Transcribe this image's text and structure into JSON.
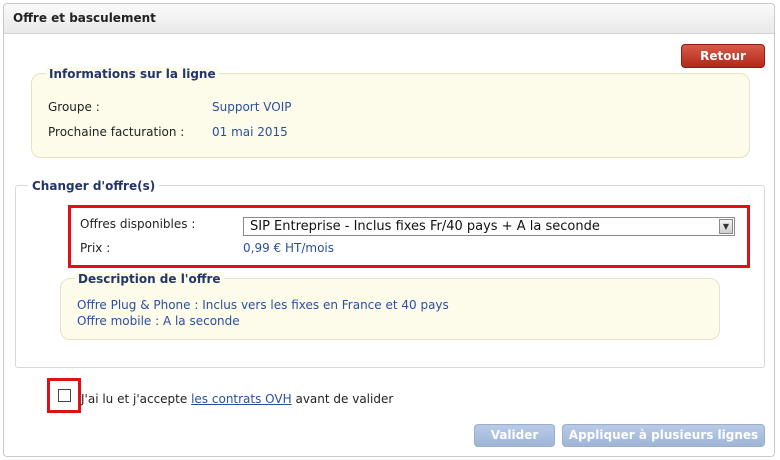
{
  "panel": {
    "title": "Offre et basculement"
  },
  "buttons": {
    "retour": "Retour",
    "valider": "Valider",
    "appliquer": "Appliquer à plusieurs lignes"
  },
  "info": {
    "legend": "Informations sur la ligne",
    "groupe_label": "Groupe :",
    "groupe_value": "Support VOIP",
    "facturation_label": "Prochaine facturation :",
    "facturation_value": "01 mai 2015"
  },
  "change": {
    "legend": "Changer d'offre(s)",
    "offres_label": "Offres disponibles :",
    "offre_selected": "SIP Entreprise - Inclus fixes Fr/40 pays + A la seconde",
    "prix_label": "Prix :",
    "prix_value": "0,99 € HT/mois"
  },
  "description": {
    "legend": "Description de l'offre",
    "line1": "Offre Plug & Phone : Inclus vers les fixes en France et 40 pays",
    "line2": "Offre mobile : A la seconde"
  },
  "accept": {
    "before": "J'ai lu et j'accepte ",
    "link": "les contrats OVH",
    "after": " avant de valider",
    "checked": false
  },
  "colors": {
    "retour_button": "#c0392b",
    "highlight_border": "#e0101a",
    "link": "#2a4fa0",
    "legend": "#22356a",
    "info_background": "#fdfcea",
    "disabled_button": "#aabfdf"
  }
}
